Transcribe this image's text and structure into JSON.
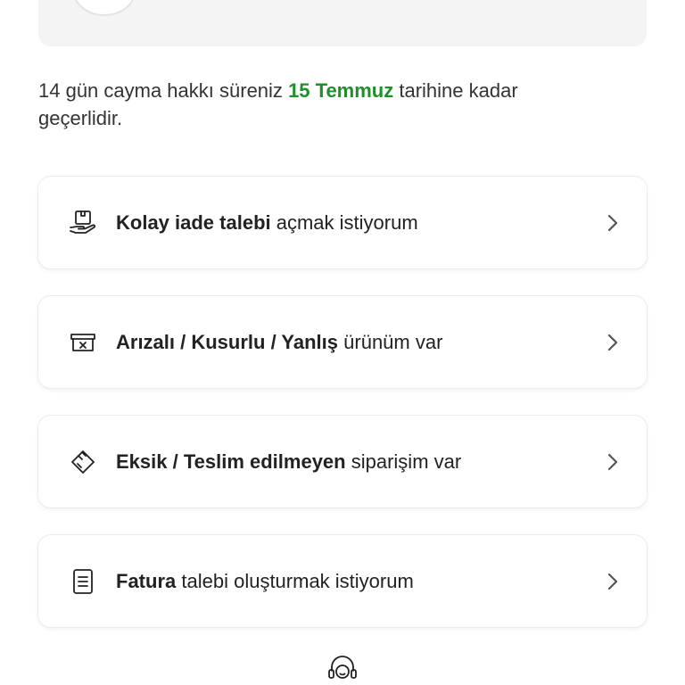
{
  "info": {
    "prefix": "14 gün cayma hakkı süreniz",
    "highlight": "15 Temmuz",
    "suffix": "tarihine kadar geçerlidir.",
    "highlight_color": "#1f8f2b"
  },
  "options": [
    {
      "icon": "box-return-hand-icon",
      "bold": "Kolay iade talebi",
      "rest": "açmak istiyorum"
    },
    {
      "icon": "damaged-box-icon",
      "bold": "Arızalı / Kusurlu / Yanlış",
      "rest": "ürünüm var"
    },
    {
      "icon": "missing-package-icon",
      "bold": "Eksik / Teslim edilmeyen",
      "rest": "siparişim var"
    },
    {
      "icon": "invoice-document-icon",
      "bold": "Fatura",
      "rest": "talebi oluşturmak istiyorum"
    }
  ],
  "footer": {
    "icon": "customer-support-icon"
  }
}
